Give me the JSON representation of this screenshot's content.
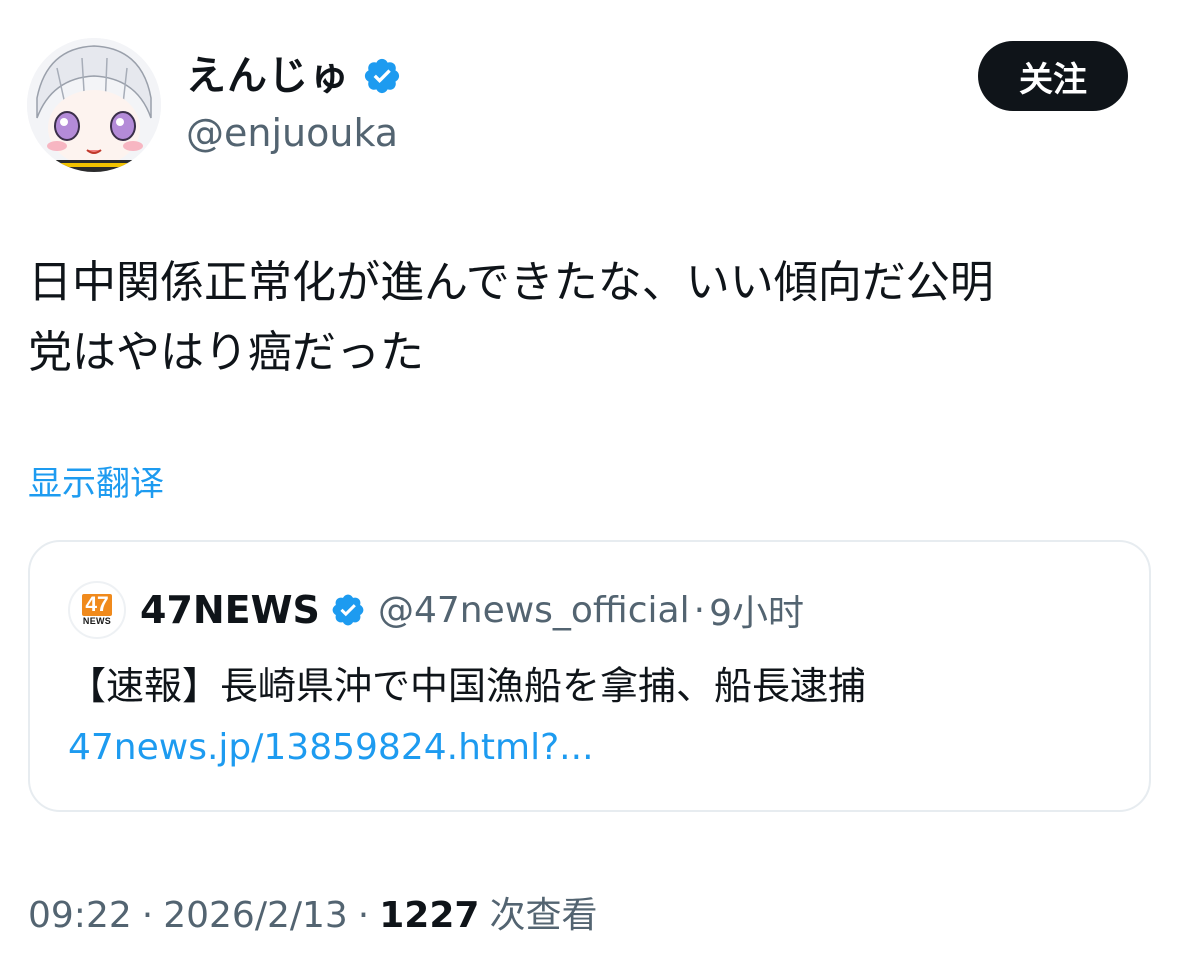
{
  "author": {
    "display_name": "えんじゅ",
    "handle": "@enjuouka",
    "verified_icon": "verified-badge-icon",
    "verified_color": "#1d9bf0"
  },
  "follow_button": {
    "label": "关注"
  },
  "tweet": {
    "text": "日中関係正常化が進んできたな、いい傾向だ公明\n党はやはり癌だった",
    "translate_label": "显示翻译"
  },
  "quote": {
    "avatar_logo_number": "47",
    "avatar_logo_word": "NEWS",
    "name": "47NEWS",
    "handle": "@47news_official",
    "separator": "·",
    "time": "9小时",
    "text": "【速報】長崎県沖で中国漁船を拿捕、船長逮捕",
    "link": "47news.jp/13859824.html?..."
  },
  "meta": {
    "time": "09:22",
    "separator": "·",
    "date": "2026/2/13",
    "views_count": "1227",
    "views_label": "次查看"
  },
  "colors": {
    "text_primary": "#0f1419",
    "text_secondary": "#536471",
    "link": "#1d9bf0",
    "border": "#e7ecf0"
  }
}
